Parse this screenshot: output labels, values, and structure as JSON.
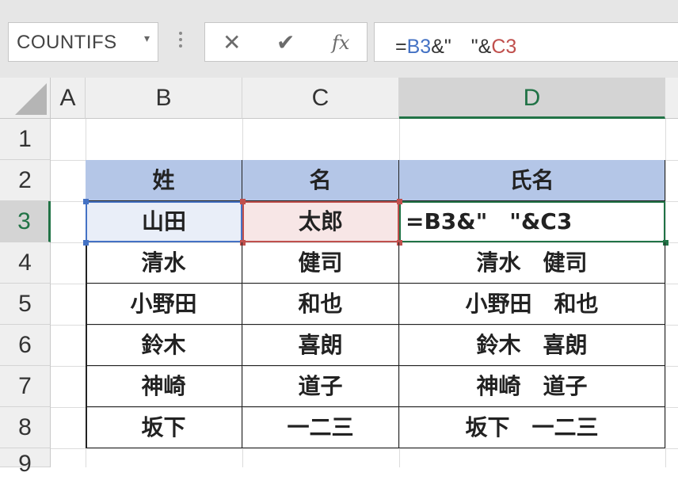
{
  "name_box": {
    "value": "COUNTIFS",
    "dropdown_icon": "chevron-down-icon"
  },
  "formula_buttons": {
    "cancel": "✕",
    "enter": "✔",
    "fx": "fx"
  },
  "formula_bar": {
    "eq": "=",
    "ref1": "B3",
    "middle": "&\"　\"&",
    "ref2": "C3"
  },
  "columns": [
    "A",
    "B",
    "C",
    "D"
  ],
  "rows": [
    "1",
    "2",
    "3",
    "4",
    "5",
    "6",
    "7",
    "8",
    "9"
  ],
  "table": {
    "headers": [
      "姓",
      "名",
      "氏名"
    ],
    "rows": [
      [
        "山田",
        "太郎",
        "=B3&\"　\"&C3"
      ],
      [
        "清水",
        "健司",
        "清水　健司"
      ],
      [
        "小野田",
        "和也",
        "小野田　和也"
      ],
      [
        "鈴木",
        "喜朗",
        "鈴木　喜朗"
      ],
      [
        "神崎",
        "道子",
        "神崎　道子"
      ],
      [
        "坂下",
        "一二三",
        "坂下　一二三"
      ]
    ]
  },
  "colors": {
    "header_fill": "#b4c6e7",
    "accent_green": "#217346",
    "ref_blue": "#4472c4",
    "ref_red": "#c0504d"
  }
}
